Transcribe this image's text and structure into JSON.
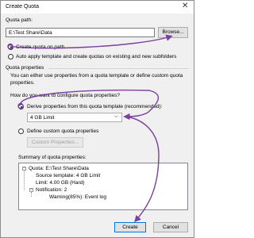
{
  "window": {
    "title": "Create Quota",
    "close_glyph": "✕"
  },
  "quota_path": {
    "label": "Quota path:",
    "value": "E:\\Test Share\\Data",
    "browse_label": "Browse..."
  },
  "options": {
    "create_on_path": "Create quota on path",
    "auto_apply": "Auto apply template and create quotas on existing and new subfolders"
  },
  "properties": {
    "group_label": "Quota properties",
    "description": "You can either use properties from a quota template or define custom quota properties.",
    "question": "How do you want to configure quota properties?",
    "derive_label": "Derive properties from this quota template (recommended):",
    "template_selected": "4 GB Limit",
    "custom_label": "Define custom quota properties",
    "custom_button": "Custom Properties..."
  },
  "summary": {
    "label": "Summary of quota properties:",
    "root": "Quota: E:\\Test Share\\Data",
    "items": [
      "Source template: 4 GB Limit",
      "Limit: 4.00 GB (Hard)",
      "Notification: 2"
    ],
    "notification_child": "Warning(85%): Event log"
  },
  "footer": {
    "create_label": "Create",
    "cancel_label": "Cancel"
  },
  "colors": {
    "annotation": "#7b3fa0",
    "accent": "#0078d7"
  }
}
